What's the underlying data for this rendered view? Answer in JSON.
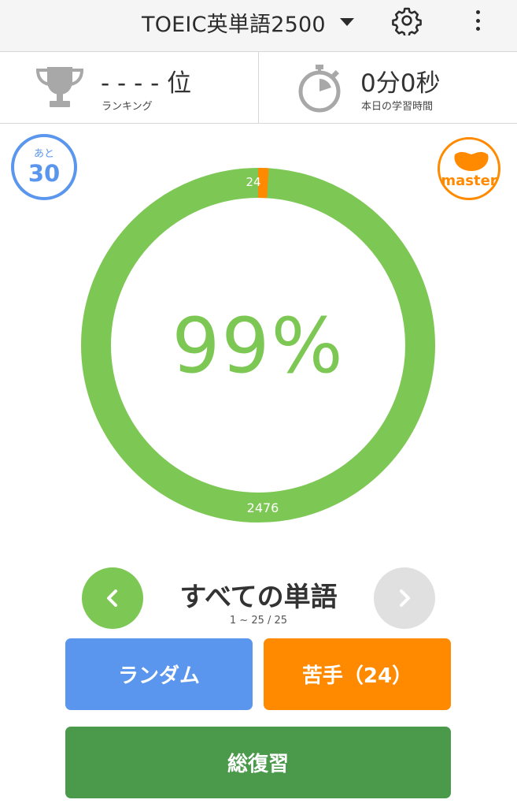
{
  "header": {
    "title": "TOEIC英単語2500"
  },
  "stats": {
    "rank_value": "- - - - 位",
    "rank_label": "ランキング",
    "time_value": "0分0秒",
    "time_label": "本日の学習時間"
  },
  "badges": {
    "remaining_prefix": "あと",
    "remaining_count": "30",
    "master_label": "master"
  },
  "progress": {
    "percent_label": "99%",
    "weak_count_label": "24",
    "known_count_label": "2476",
    "known_count": 2476,
    "weak_count": 24,
    "total": 2500
  },
  "word_set": {
    "title": "すべての単語",
    "range": "1 ~ 25 / 25"
  },
  "buttons": {
    "random": "ランダム",
    "weak": "苦手（24）",
    "review": "総復習"
  },
  "colors": {
    "green": "#7dc754",
    "orange": "#ff8a00",
    "blue": "#5a95ee",
    "dark_green": "#4b9a4c",
    "disabled_grey": "#e0e0e0"
  }
}
